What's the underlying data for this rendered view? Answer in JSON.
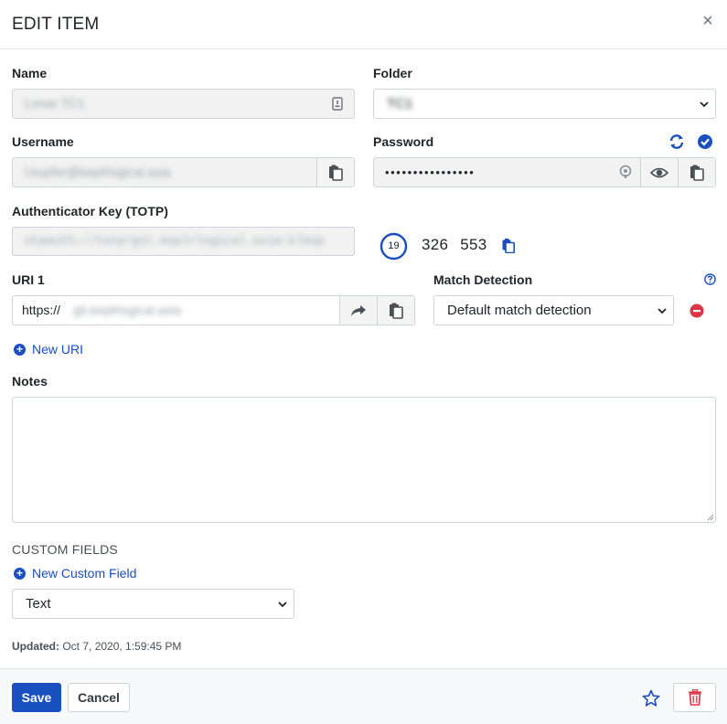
{
  "dialog": {
    "title": "EDIT ITEM",
    "close_glyph": "×"
  },
  "name": {
    "label": "Name",
    "value": "Lenar TC1",
    "icon": "generator-icon"
  },
  "folder": {
    "label": "Folder",
    "value": "TC1"
  },
  "username": {
    "label": "Username",
    "value": "l.kopfer@keplrlogical.asia"
  },
  "password": {
    "label": "Password",
    "value": "••••••••••••••••"
  },
  "totp": {
    "label": "Authenticator Key (TOTP)",
    "value": "otpauth://totp/git.keplrlogical.asia:kleop",
    "timer": "19",
    "code": "326 553"
  },
  "uri": {
    "label": "URI 1",
    "prefix": "https://",
    "host": "git.keplrlogical.asia"
  },
  "match": {
    "label": "Match Detection",
    "value": "Default match detection"
  },
  "new_uri": {
    "label": "New URI"
  },
  "notes": {
    "label": "Notes",
    "value": ""
  },
  "custom_fields": {
    "title": "CUSTOM FIELDS",
    "new_label": "New Custom Field",
    "type_value": "Text"
  },
  "updated": {
    "label": "Updated:",
    "value": "Oct 7, 2020, 1:59:45 PM"
  },
  "footer": {
    "save": "Save",
    "cancel": "Cancel"
  },
  "colors": {
    "accent": "#1a4fbf",
    "danger": "#dc3545",
    "field_border": "#ced4da"
  }
}
